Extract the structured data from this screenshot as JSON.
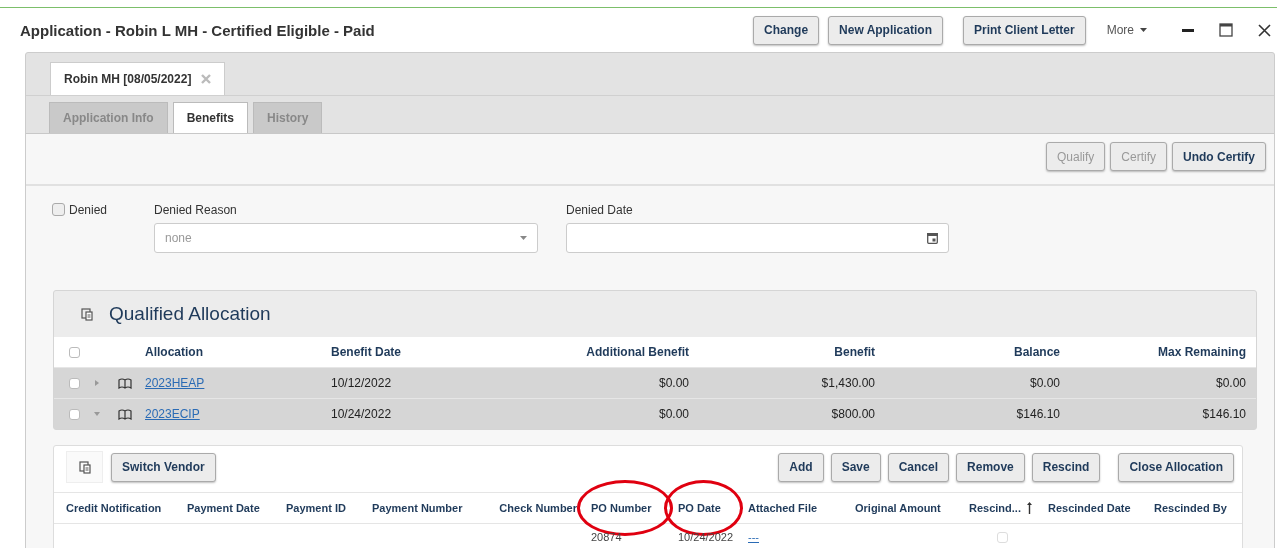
{
  "window": {
    "title": "Application - Robin L MH - Certified Eligible - Paid",
    "buttons": [
      "Change",
      "New Application",
      "Print Client Letter"
    ],
    "more_menu": "More"
  },
  "client_tabs": [
    {
      "label": "Robin MH [08/05/2022]"
    }
  ],
  "tabs": [
    {
      "label": "Application Info",
      "selected": false
    },
    {
      "label": "Benefits",
      "selected": true
    },
    {
      "label": "History",
      "selected": false
    }
  ],
  "actions": [
    {
      "label": "Qualify",
      "disabled": true
    },
    {
      "label": "Certify",
      "disabled": true
    },
    {
      "label": "Undo Certify",
      "disabled": false
    }
  ],
  "denial": {
    "denied": {
      "label": "Denied",
      "checked": false
    },
    "reason": {
      "label": "Denied Reason",
      "value": "none"
    },
    "date": {
      "label": "Denied Date"
    }
  },
  "allocation_panel": {
    "title": "Qualified Allocation",
    "header_checked": false,
    "columns": [
      "Allocation",
      "Benefit Date",
      "Additional Benefit",
      "Benefit",
      "Balance",
      "Max Remaining"
    ],
    "rows": [
      {
        "checked": false,
        "expanded": false,
        "allocation": "2023HEAP",
        "benefit_date": "10/12/2022",
        "additional_benefit": "$0.00",
        "benefit": "$1,430.00",
        "balance": "$0.00",
        "max_remaining": "$0.00"
      },
      {
        "checked": false,
        "expanded": true,
        "allocation": "2023ECIP",
        "benefit_date": "10/24/2022",
        "additional_benefit": "$0.00",
        "benefit": "$800.00",
        "balance": "$146.10",
        "max_remaining": "$146.10"
      }
    ]
  },
  "payments": {
    "switch_vendor": "Switch Vendor",
    "buttons": [
      "Add",
      "Save",
      "Cancel",
      "Remove",
      "Rescind",
      "Close Allocation"
    ],
    "columns": [
      {
        "label": "Credit Notification",
        "highlighted": false,
        "sorted": false
      },
      {
        "label": "Payment Date",
        "highlighted": false,
        "sorted": false
      },
      {
        "label": "Payment ID",
        "highlighted": false,
        "sorted": false
      },
      {
        "label": "Payment Number",
        "highlighted": false,
        "sorted": false
      },
      {
        "label": "Check Number",
        "highlighted": false,
        "sorted": false
      },
      {
        "label": "PO Number",
        "highlighted": true,
        "sorted": false
      },
      {
        "label": "PO Date",
        "highlighted": true,
        "sorted": false
      },
      {
        "label": "Attached File",
        "highlighted": false,
        "sorted": false
      },
      {
        "label": "Original Amount",
        "highlighted": false,
        "sorted": false
      },
      {
        "label": "Rescind...",
        "highlighted": false,
        "sorted": true
      },
      {
        "label": "Rescinded Date",
        "highlighted": false,
        "sorted": false
      },
      {
        "label": "Rescinded By",
        "highlighted": false,
        "sorted": false
      }
    ],
    "rows": [
      {
        "cells": [
          {
            "kind": "empty"
          },
          {
            "kind": "empty"
          },
          {
            "kind": "empty"
          },
          {
            "kind": "empty"
          },
          {
            "kind": "empty"
          },
          {
            "kind": "text",
            "text": "20874"
          },
          {
            "kind": "text",
            "text": "10/24/2022"
          },
          {
            "kind": "link",
            "text": "---"
          },
          {
            "kind": "empty"
          },
          {
            "kind": "checkbox",
            "checked": false
          },
          {
            "kind": "empty"
          },
          {
            "kind": "empty"
          }
        ]
      }
    ]
  }
}
